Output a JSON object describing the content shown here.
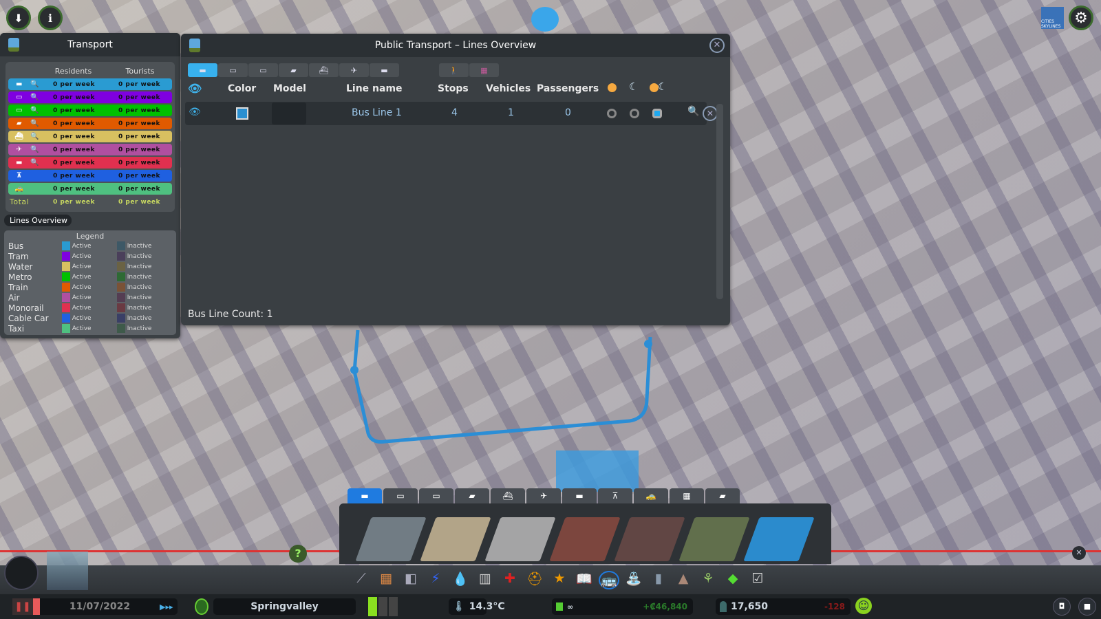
{
  "top": {
    "icons": [
      "unlock-icon",
      "info-icon"
    ],
    "right_icons": [
      "cities-skylines-logo",
      "settings-gear-icon"
    ],
    "logo_text": "CITIES SKYLINES"
  },
  "transport": {
    "title": "Transport",
    "headers": [
      "Residents",
      "Tourists"
    ],
    "rows": [
      {
        "icon": "bus-icon",
        "glyph": "▬",
        "color": "#2a9bd2",
        "residents": "0 per week",
        "tourists": "0 per week",
        "search": true
      },
      {
        "icon": "tram-icon",
        "glyph": "▭",
        "color": "#7f00e0",
        "residents": "0 per week",
        "tourists": "0 per week",
        "search": true
      },
      {
        "icon": "metro-icon",
        "glyph": "▭",
        "color": "#00c000",
        "residents": "0 per week",
        "tourists": "0 per week",
        "search": true
      },
      {
        "icon": "train-icon",
        "glyph": "▰",
        "color": "#e05a00",
        "residents": "0 per week",
        "tourists": "0 per week",
        "search": true
      },
      {
        "icon": "ship-icon",
        "glyph": "⛴",
        "color": "#d8c060",
        "residents": "0 per week",
        "tourists": "0 per week",
        "search": true
      },
      {
        "icon": "plane-icon",
        "glyph": "✈",
        "color": "#b04fa0",
        "residents": "0 per week",
        "tourists": "0 per week",
        "search": true
      },
      {
        "icon": "monorail-icon",
        "glyph": "▬",
        "color": "#e0304f",
        "residents": "0 per week",
        "tourists": "0 per week",
        "search": true
      },
      {
        "icon": "cable-car-icon",
        "glyph": "⊼",
        "color": "#1f60e0",
        "residents": "0 per week",
        "tourists": "0 per week",
        "search": false
      },
      {
        "icon": "taxi-icon",
        "glyph": "🚕",
        "color": "#4fc080",
        "residents": "0 per week",
        "tourists": "0 per week",
        "search": false
      }
    ],
    "total": {
      "label": "Total",
      "residents": "0 per week",
      "tourists": "0 per week"
    },
    "lines_overview_button": "Lines Overview",
    "legend": {
      "title": "Legend",
      "active": "Active",
      "inactive": "Inactive",
      "items": [
        {
          "name": "Bus",
          "active": "#2a9bd2",
          "inactive": "#3d5866"
        },
        {
          "name": "Tram",
          "active": "#7f00e0",
          "inactive": "#4a3f5a"
        },
        {
          "name": "Water",
          "active": "#d8c060",
          "inactive": "#6a6244"
        },
        {
          "name": "Metro",
          "active": "#00c000",
          "inactive": "#2e6a34"
        },
        {
          "name": "Train",
          "active": "#e05a00",
          "inactive": "#7a5236"
        },
        {
          "name": "Air",
          "active": "#b04fa0",
          "inactive": "#543d52"
        },
        {
          "name": "Monorail",
          "active": "#e0304f",
          "inactive": "#6a3a42"
        },
        {
          "name": "Cable Car",
          "active": "#1f60e0",
          "inactive": "#3a3f66"
        },
        {
          "name": "Taxi",
          "active": "#4fc080",
          "inactive": "#3e5a4a"
        }
      ]
    }
  },
  "lines": {
    "title": "Public Transport – Lines Overview",
    "tabs": [
      {
        "icon": "bus-icon",
        "glyph": "▬",
        "active": true
      },
      {
        "icon": "tram-icon",
        "glyph": "▭"
      },
      {
        "icon": "metro-icon",
        "glyph": "▭"
      },
      {
        "icon": "train-icon",
        "glyph": "▰"
      },
      {
        "icon": "ship-icon",
        "glyph": "⛴"
      },
      {
        "icon": "plane-icon",
        "glyph": "✈"
      },
      {
        "icon": "monorail-icon",
        "glyph": "▬"
      }
    ],
    "extra_tabs": [
      {
        "icon": "walking-tour-icon",
        "glyph": "🚶"
      },
      {
        "icon": "sightseeing-bus-icon",
        "glyph": "▦"
      }
    ],
    "columns": {
      "color": "Color",
      "model": "Model",
      "name": "Line name",
      "stops": "Stops",
      "vehicles": "Vehicles",
      "passengers": "Passengers"
    },
    "rows": [
      {
        "visible": true,
        "color": "#2a8fd0",
        "name": "Bus Line 1",
        "stops": "4",
        "vehicles": "1",
        "passengers": "0",
        "schedule": "day-and-night"
      }
    ],
    "footer": "Bus Line Count: 1"
  },
  "toolbar": {
    "tabs": [
      "bus-icon",
      "tram-icon",
      "metro-icon",
      "train-icon",
      "ship-icon",
      "plane-icon",
      "monorail-icon",
      "cable-car-icon",
      "taxi-icon",
      "tour-bus-icon",
      "intercity-bus-icon"
    ],
    "active_tab": 0,
    "assets": [
      "bus-depot",
      "bus-terminal",
      "bus-station",
      "road-bus-taxi-lanes",
      "road-bus-lanes",
      "road-trees-bus-taxi",
      "bus-stop"
    ],
    "help": "?"
  },
  "status": {
    "date": "11/07/2022",
    "city": "Springvalley",
    "temperature": "14.3°C",
    "money": "∞",
    "income": "+₡46,840",
    "population": "17,650",
    "population_change": "-128",
    "speed_icon": "fast-forward-icon",
    "happiness": "happy-icon"
  }
}
